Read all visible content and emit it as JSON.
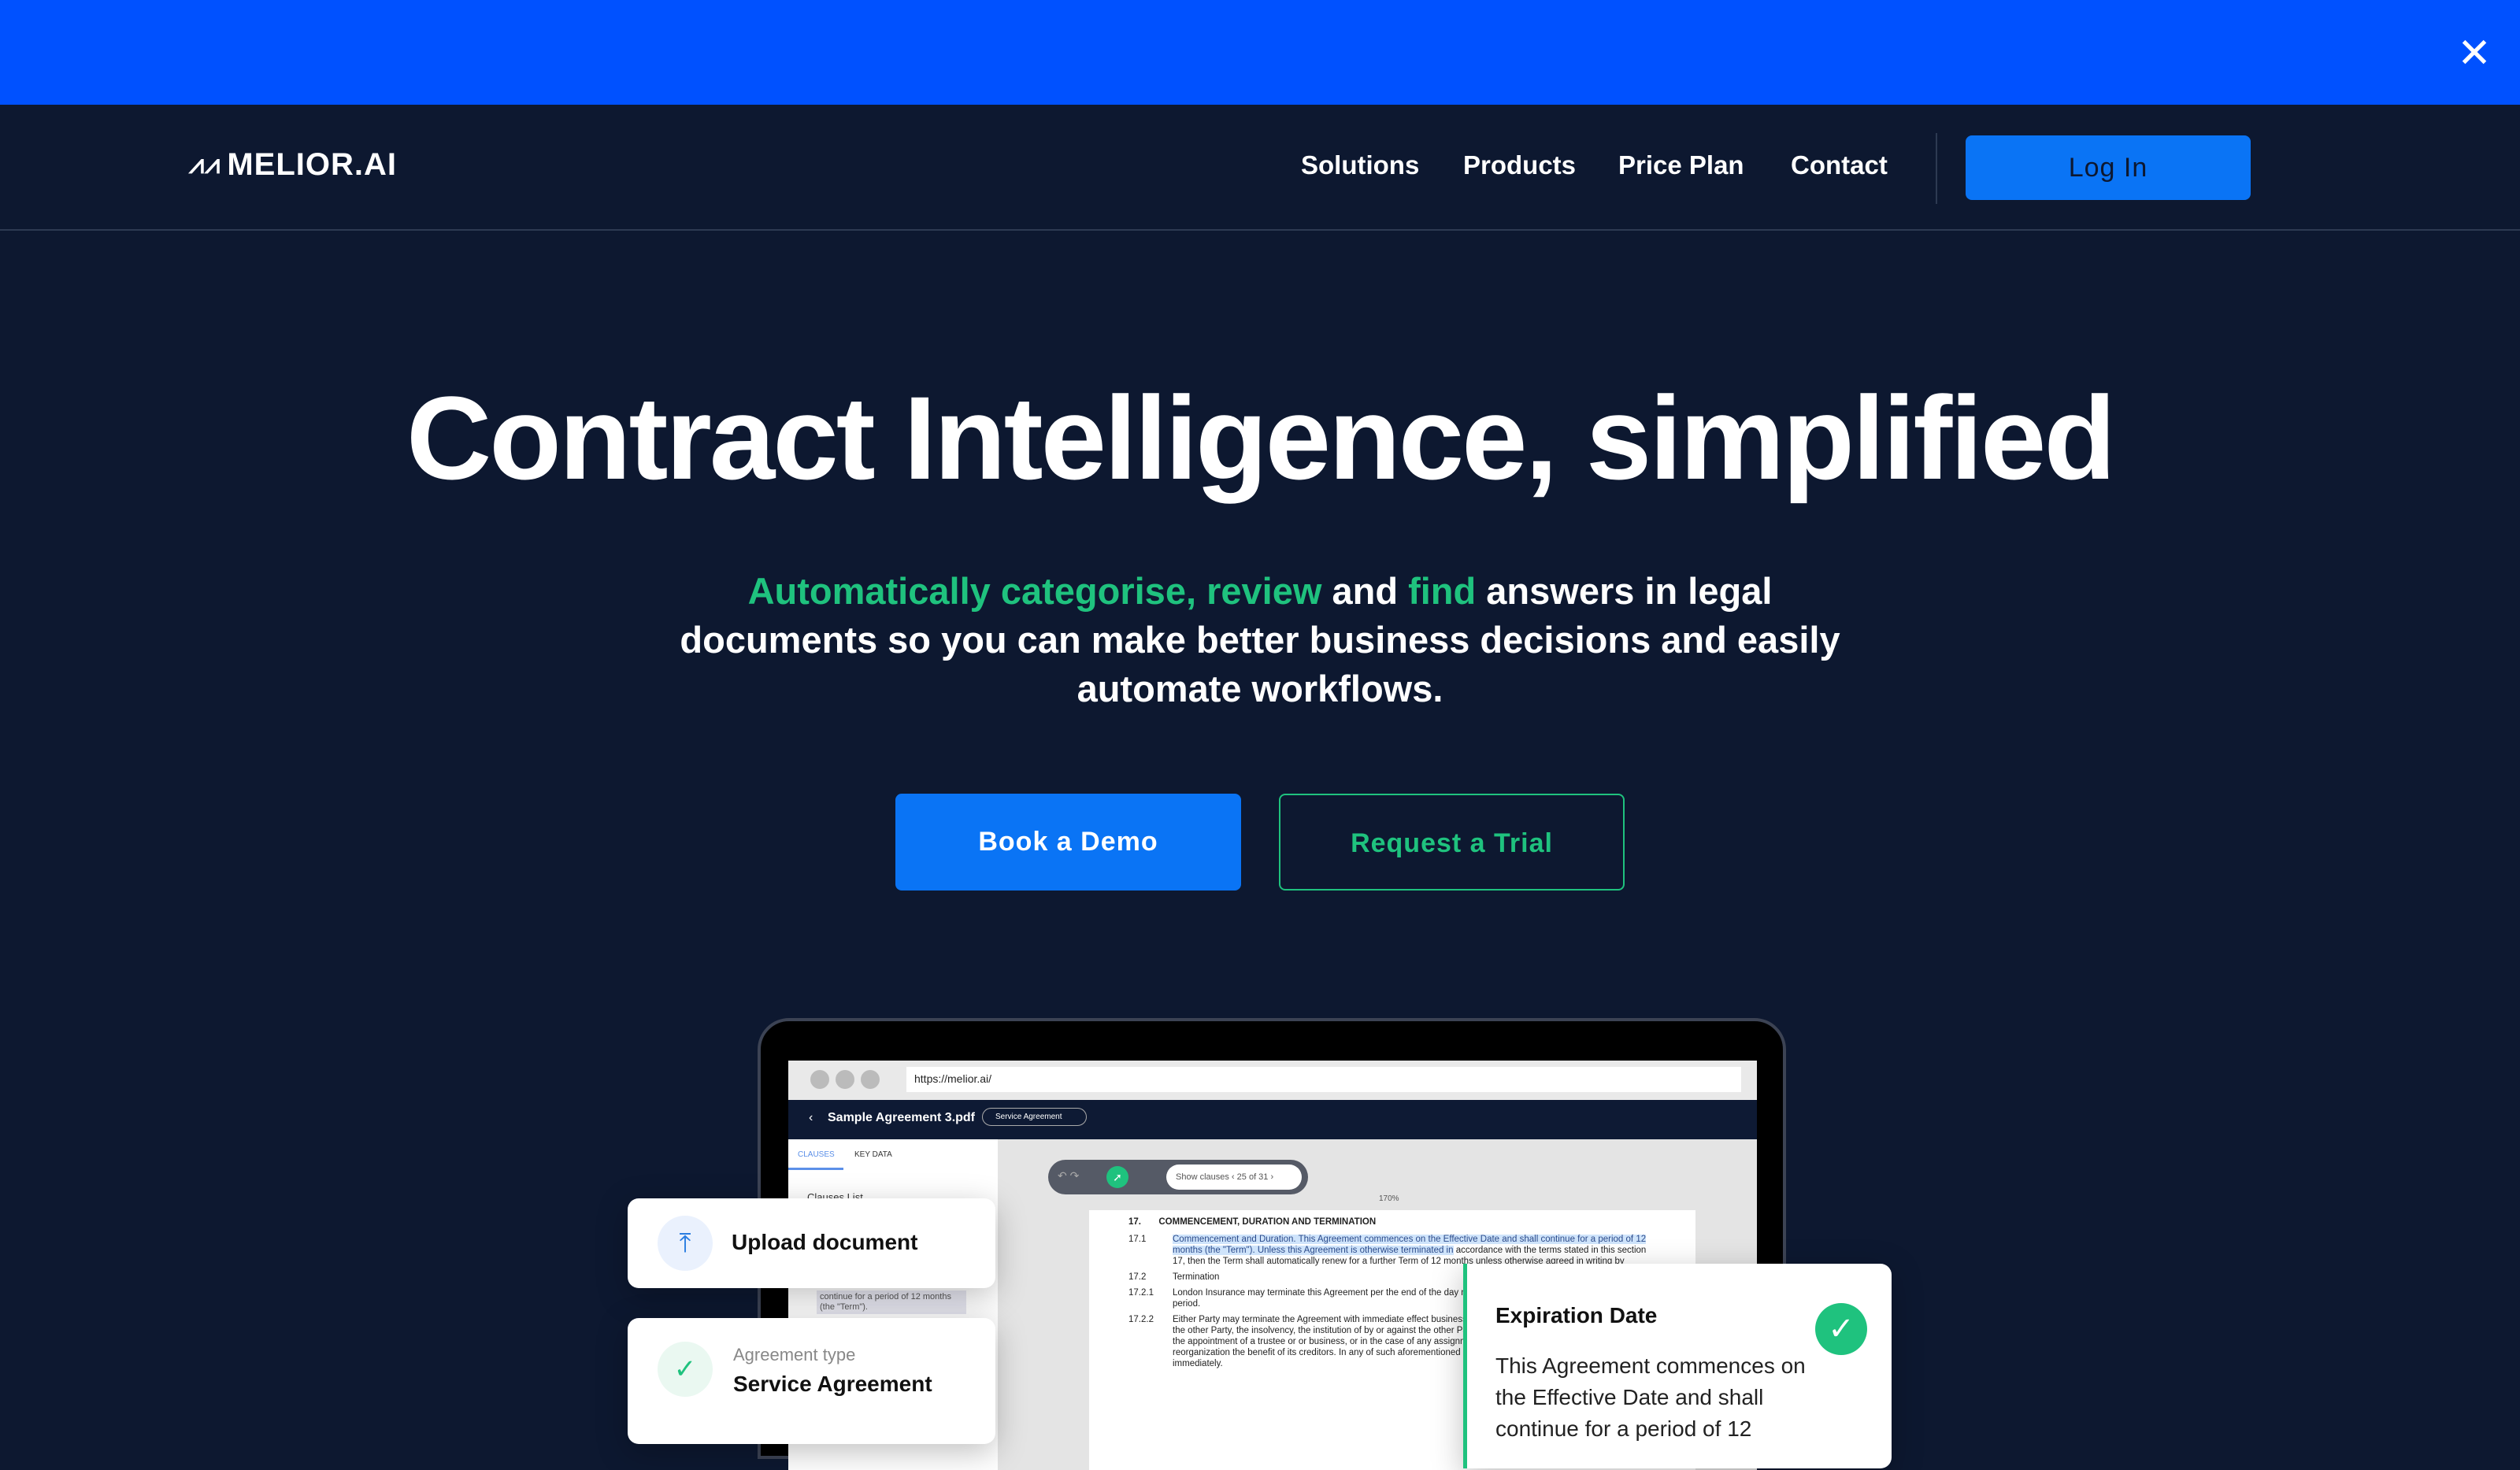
{
  "banner": {
    "close_icon": "close-icon"
  },
  "nav": {
    "logo": "MELIOR.AI",
    "items": [
      "Solutions",
      "Products",
      "Price Plan",
      "Contact"
    ],
    "login": "Log In"
  },
  "hero": {
    "headline": "Contract Intelligence, simplified",
    "sub": {
      "g1": "Automatically categorise, review",
      "t1": " and ",
      "g2": "find",
      "t2": " answers in legal documents so you can make better business decisions and easily automate workflows."
    },
    "demo": "Book a Demo",
    "trial": "Request a Trial"
  },
  "colors": {
    "accent_blue": "#0a74f5",
    "banner_blue": "#0051ff",
    "accent_green": "#1fc27e",
    "background": "#0d1830"
  },
  "app": {
    "url": "https://melior.ai/",
    "file": "Sample Agreement 3.pdf",
    "type_select": "Service Agreement",
    "tabs": [
      "CLAUSES",
      "KEY DATA"
    ],
    "clauses_list": "Clauses List",
    "side_snippet": "continue for a period of 12 months (the \"Term\").",
    "show_clauses": "Show clauses",
    "clause_count": "25 of 31",
    "zoom": "170%",
    "doc": {
      "h_num": "17.",
      "h": "COMMENCEMENT, DURATION AND TERMINATION",
      "p1_num": "17.1",
      "p1_hl": "Commencement and Duration.  This Agreement commences on the Effective Date and shall continue for a period of 12 months (the \"Term\").  Unless this Agreement is otherwise terminated in",
      "p1_rest": "accordance with the terms stated in this section 17, then the Term shall automatically renew for a further Term of 12 months unless otherwise agreed in writing by",
      "p2_num": "17.2",
      "p2": "Termination",
      "p3_num": "17.2.1",
      "p3": "London Insurance may terminate this Agreement per the end of the day notice period.",
      "p4_num": "17.2.2",
      "p4": "Either Party may terminate the Agreement with immediate effect business by the other Party, the insolvency, the institution of by or against the other Party, the appointment of a trustee or or business, or in the case of any assignment, reorganization the benefit of its creditors. In any of such aforementioned immediately."
    }
  },
  "cards": {
    "upload": "Upload document",
    "type_label": "Agreement type",
    "type_value": "Service Agreement",
    "exp_title": "Expiration Date",
    "exp_text": "This Agreement commences on the Effective Date and shall continue for a period of 12"
  }
}
